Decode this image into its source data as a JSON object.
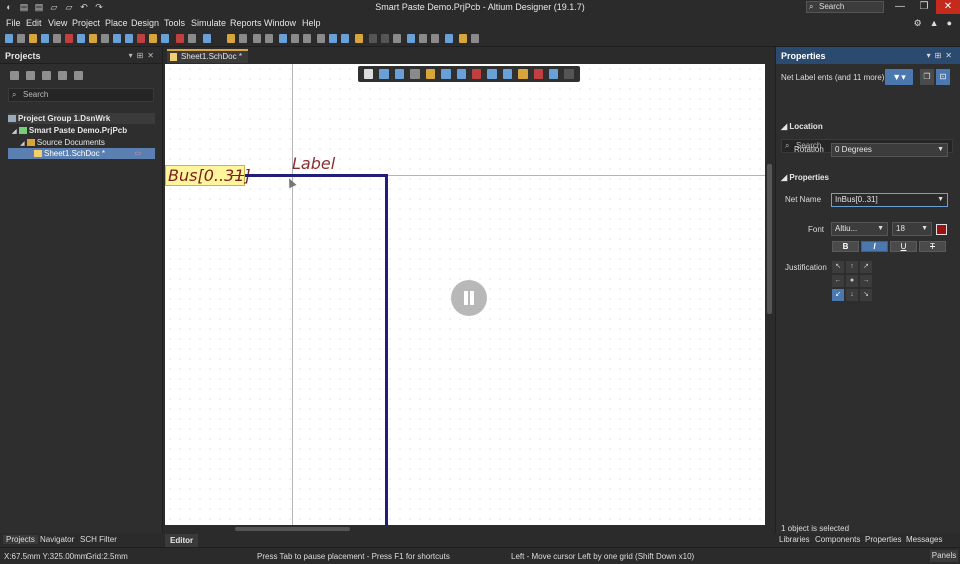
{
  "titlebar": {
    "title": "Smart Paste Demo.PrjPcb - Altium Designer (19.1.7)",
    "search_placeholder": "Search"
  },
  "menu": [
    "File",
    "Edit",
    "View",
    "Project",
    "Place",
    "Design",
    "Tools",
    "Simulate",
    "Reports",
    "Window",
    "Help"
  ],
  "projects_panel": {
    "title": "Projects",
    "search_placeholder": "Search",
    "tree": [
      {
        "label": "Project Group 1.DsnWrk"
      },
      {
        "label": "Smart Paste Demo.PrjPcb"
      },
      {
        "label": "Source Documents"
      },
      {
        "label": "Sheet1.SchDoc *"
      }
    ],
    "bottom_tabs": [
      "Projects",
      "Navigator",
      "SCH Filter"
    ]
  },
  "document": {
    "tab": "Sheet1.SchDoc *",
    "port_text": "Bus[0..31]",
    "net_label_text": "Label",
    "editor_tab": "Editor"
  },
  "properties": {
    "title": "Properties",
    "filter_text": "Net Label  ents (and 11 more)",
    "search_placeholder": "Search",
    "location_section": "Location",
    "rotation_label": "Rotation",
    "rotation_value": "0 Degrees",
    "properties_section": "Properties",
    "net_name_label": "Net Name",
    "net_name_value": "InBus[0..31]",
    "font_label": "Font",
    "font_name": "Altiu...",
    "font_size": "18",
    "font_color": "#9b1111",
    "style_buttons": [
      "B",
      "I",
      "U",
      "T"
    ],
    "justification_label": "Justification",
    "justification_arrows": [
      "↖",
      "↑",
      "↗",
      "←",
      "●",
      "→",
      "↙",
      "↓",
      "↘"
    ],
    "selection_status": "1 object is selected",
    "bottom_tabs": [
      "Libraries",
      "Components",
      "Properties",
      "Messages"
    ]
  },
  "statusbar": {
    "coords": "X:67.5mm Y:325.00mm",
    "grid": "Grid:2.5mm",
    "hint": "Press Tab to pause placement - Press F1 for shortcuts",
    "hint_right": "Left - Move cursor Left by one grid (Shift Down x10)",
    "panels": "Panels"
  },
  "colors": {
    "accent": "#4c78b0",
    "wire": "#1f1f7a",
    "port_fill": "#fff59d",
    "label": "#8b2d2d",
    "tab_highlight": "#d8a53a"
  }
}
